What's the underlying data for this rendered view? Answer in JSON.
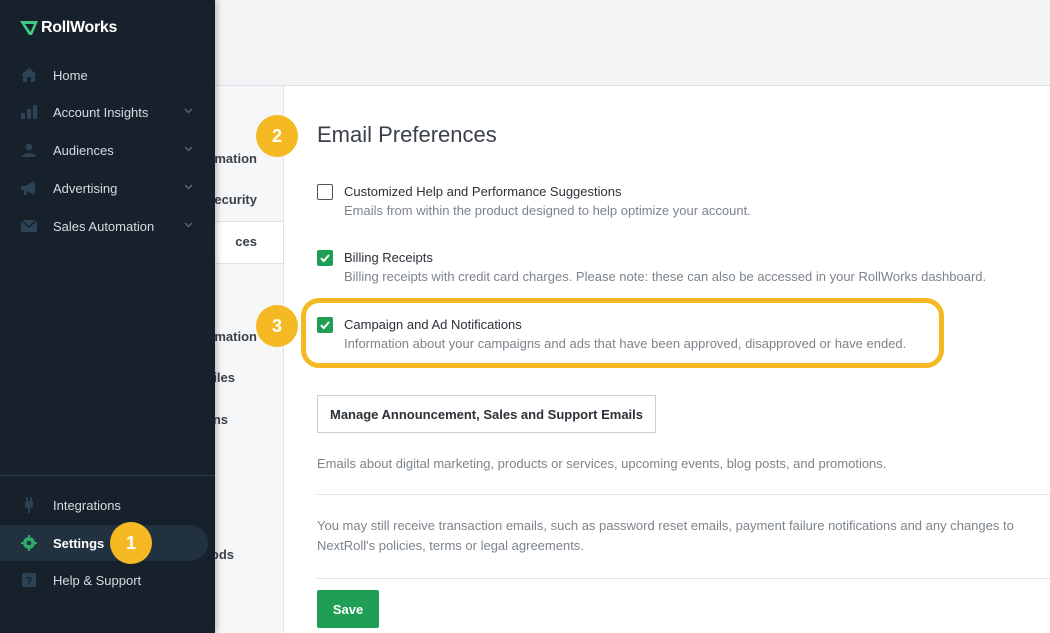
{
  "brand": {
    "name": "RollWorks"
  },
  "sidebar": {
    "items": [
      {
        "label": "Home",
        "icon": "home-icon"
      },
      {
        "label": "Account Insights",
        "icon": "chart-icon"
      },
      {
        "label": "Audiences",
        "icon": "people-icon"
      },
      {
        "label": "Advertising",
        "icon": "megaphone-icon"
      },
      {
        "label": "Sales Automation",
        "icon": "mail-icon"
      }
    ],
    "bottom_items": [
      {
        "label": "Integrations",
        "icon": "plug-icon"
      },
      {
        "label": "Settings",
        "icon": "gear-icon"
      },
      {
        "label": "Help & Support",
        "icon": "question-icon"
      }
    ]
  },
  "subnav": {
    "items": [
      "mation",
      "Security",
      "ces",
      "mation",
      "iles",
      "ns",
      "ods"
    ]
  },
  "main": {
    "title": "Email Preferences",
    "preferences": [
      {
        "label": "Customized Help and Performance Suggestions",
        "description": "Emails from within the product designed to help optimize your account.",
        "checked": false
      },
      {
        "label": "Billing Receipts",
        "description": "Billing receipts with credit card charges. Please note: these can also be accessed in your RollWorks dashboard.",
        "checked": true
      },
      {
        "label": "Campaign and Ad Notifications",
        "description": "Information about your campaigns and ads that have been approved, disapproved or have ended.",
        "checked": true
      }
    ],
    "manage_button": "Manage Announcement, Sales and Support Emails",
    "manage_description": "Emails about digital marketing, products or services, upcoming events, blog posts, and promotions.",
    "note": "You may still receive transaction emails, such as password reset emails, payment failure notifications and any changes to NextRoll's policies, terms or legal agreements.",
    "save_button": "Save"
  },
  "badges": [
    "1",
    "2",
    "3"
  ],
  "colors": {
    "sidebar_bg": "#17212c",
    "accent_green": "#1f9e55",
    "highlight_yellow": "#f5b924"
  }
}
